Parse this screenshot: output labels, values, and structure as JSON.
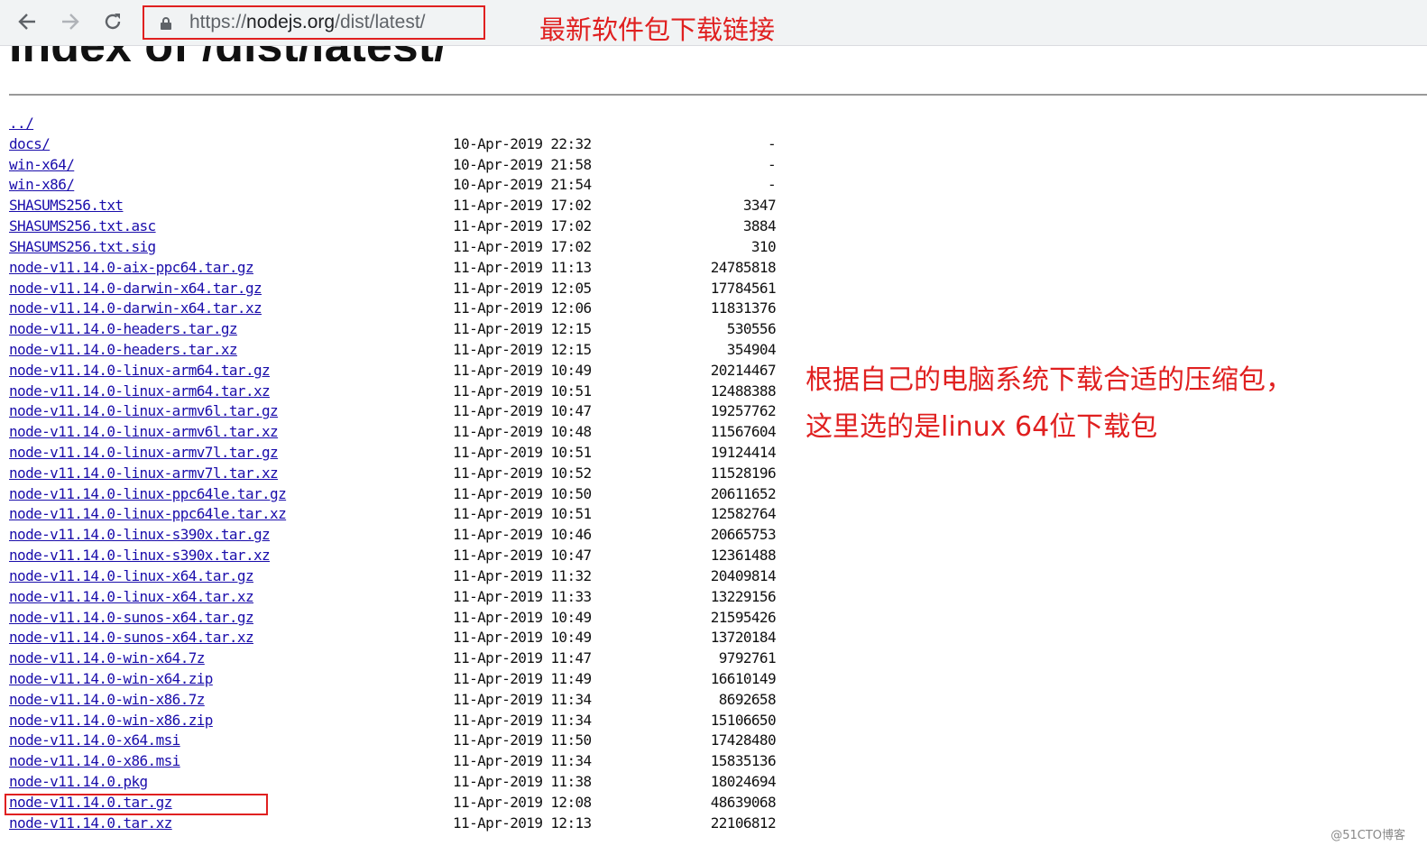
{
  "browser": {
    "url_prefix": "https://",
    "url_host": "nodejs.org",
    "url_path": "/dist/latest/",
    "icons": [
      "back-arrow-icon",
      "forward-arrow-icon",
      "reload-icon",
      "lock-icon"
    ]
  },
  "page": {
    "heading": "Index of /dist/latest/",
    "parent_link": "../"
  },
  "annotations": {
    "top": "最新软件包下载链接",
    "side_line1": "根据自己的电脑系统下载合适的压缩包，",
    "side_line2": "这里选的是linux 64位下载包",
    "highlight_color": "#e02020"
  },
  "watermark": "@51CTO博客",
  "files": [
    {
      "name": "docs/",
      "date": "10-Apr-2019 22:32",
      "size": "-"
    },
    {
      "name": "win-x64/",
      "date": "10-Apr-2019 21:58",
      "size": "-"
    },
    {
      "name": "win-x86/",
      "date": "10-Apr-2019 21:54",
      "size": "-"
    },
    {
      "name": "SHASUMS256.txt",
      "date": "11-Apr-2019 17:02",
      "size": "3347"
    },
    {
      "name": "SHASUMS256.txt.asc",
      "date": "11-Apr-2019 17:02",
      "size": "3884"
    },
    {
      "name": "SHASUMS256.txt.sig",
      "date": "11-Apr-2019 17:02",
      "size": "310"
    },
    {
      "name": "node-v11.14.0-aix-ppc64.tar.gz",
      "date": "11-Apr-2019 11:13",
      "size": "24785818"
    },
    {
      "name": "node-v11.14.0-darwin-x64.tar.gz",
      "date": "11-Apr-2019 12:05",
      "size": "17784561"
    },
    {
      "name": "node-v11.14.0-darwin-x64.tar.xz",
      "date": "11-Apr-2019 12:06",
      "size": "11831376"
    },
    {
      "name": "node-v11.14.0-headers.tar.gz",
      "date": "11-Apr-2019 12:15",
      "size": "530556"
    },
    {
      "name": "node-v11.14.0-headers.tar.xz",
      "date": "11-Apr-2019 12:15",
      "size": "354904"
    },
    {
      "name": "node-v11.14.0-linux-arm64.tar.gz",
      "date": "11-Apr-2019 10:49",
      "size": "20214467"
    },
    {
      "name": "node-v11.14.0-linux-arm64.tar.xz",
      "date": "11-Apr-2019 10:51",
      "size": "12488388"
    },
    {
      "name": "node-v11.14.0-linux-armv6l.tar.gz",
      "date": "11-Apr-2019 10:47",
      "size": "19257762"
    },
    {
      "name": "node-v11.14.0-linux-armv6l.tar.xz",
      "date": "11-Apr-2019 10:48",
      "size": "11567604"
    },
    {
      "name": "node-v11.14.0-linux-armv7l.tar.gz",
      "date": "11-Apr-2019 10:51",
      "size": "19124414"
    },
    {
      "name": "node-v11.14.0-linux-armv7l.tar.xz",
      "date": "11-Apr-2019 10:52",
      "size": "11528196"
    },
    {
      "name": "node-v11.14.0-linux-ppc64le.tar.gz",
      "date": "11-Apr-2019 10:50",
      "size": "20611652"
    },
    {
      "name": "node-v11.14.0-linux-ppc64le.tar.xz",
      "date": "11-Apr-2019 10:51",
      "size": "12582764"
    },
    {
      "name": "node-v11.14.0-linux-s390x.tar.gz",
      "date": "11-Apr-2019 10:46",
      "size": "20665753"
    },
    {
      "name": "node-v11.14.0-linux-s390x.tar.xz",
      "date": "11-Apr-2019 10:47",
      "size": "12361488"
    },
    {
      "name": "node-v11.14.0-linux-x64.tar.gz",
      "date": "11-Apr-2019 11:32",
      "size": "20409814"
    },
    {
      "name": "node-v11.14.0-linux-x64.tar.xz",
      "date": "11-Apr-2019 11:33",
      "size": "13229156"
    },
    {
      "name": "node-v11.14.0-sunos-x64.tar.gz",
      "date": "11-Apr-2019 10:49",
      "size": "21595426"
    },
    {
      "name": "node-v11.14.0-sunos-x64.tar.xz",
      "date": "11-Apr-2019 10:49",
      "size": "13720184"
    },
    {
      "name": "node-v11.14.0-win-x64.7z",
      "date": "11-Apr-2019 11:47",
      "size": "9792761"
    },
    {
      "name": "node-v11.14.0-win-x64.zip",
      "date": "11-Apr-2019 11:49",
      "size": "16610149"
    },
    {
      "name": "node-v11.14.0-win-x86.7z",
      "date": "11-Apr-2019 11:34",
      "size": "8692658"
    },
    {
      "name": "node-v11.14.0-win-x86.zip",
      "date": "11-Apr-2019 11:34",
      "size": "15106650"
    },
    {
      "name": "node-v11.14.0-x64.msi",
      "date": "11-Apr-2019 11:50",
      "size": "17428480"
    },
    {
      "name": "node-v11.14.0-x86.msi",
      "date": "11-Apr-2019 11:34",
      "size": "15835136"
    },
    {
      "name": "node-v11.14.0.pkg",
      "date": "11-Apr-2019 11:38",
      "size": "18024694"
    },
    {
      "name": "node-v11.14.0.tar.gz",
      "date": "11-Apr-2019 12:08",
      "size": "48639068"
    },
    {
      "name": "node-v11.14.0.tar.xz",
      "date": "11-Apr-2019 12:13",
      "size": "22106812"
    }
  ]
}
